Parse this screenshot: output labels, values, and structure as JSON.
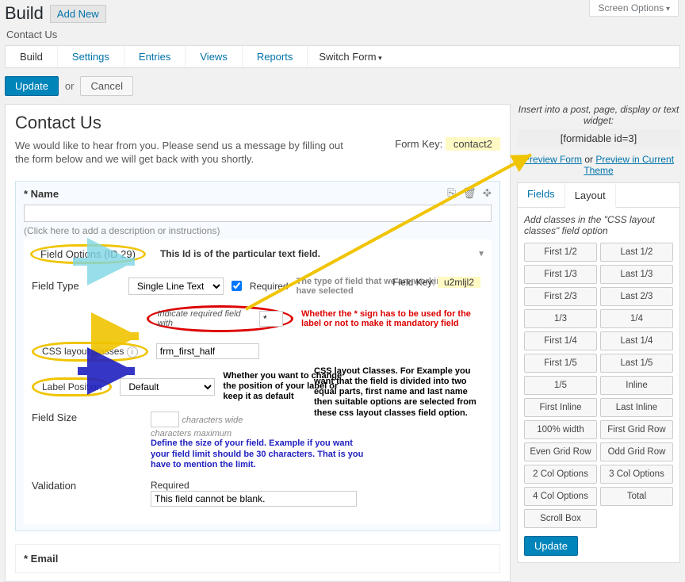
{
  "screen_options": "Screen Options",
  "page_title": "Build",
  "add_new": "Add New",
  "breadcrumb": "Contact Us",
  "tabs": [
    "Build",
    "Settings",
    "Entries",
    "Views",
    "Reports"
  ],
  "switch_form": "Switch Form",
  "update": "Update",
  "or": "or",
  "cancel": "Cancel",
  "form_title": "Contact Us",
  "form_intro": "We would like to hear from you. Please send us a message by filling out the form below and we will get back with you shortly.",
  "form_key_label": "Form Key:",
  "form_key_value": "contact2",
  "name_label": "Name",
  "desc_hint": "(Click here to add a description or instructions)",
  "field_options": "Field Options (ID 29)",
  "note_id": "This Id is of the particular text field.",
  "field_type_lbl": "Field Type",
  "field_type_val": "Single Line Text",
  "required_lbl": "Required",
  "field_type_note": "The type of field that we are working on or have selected",
  "field_key_lbl": "Field Key:",
  "field_key_val": "u2mljl2",
  "indicate_lbl": "Indicate required field with",
  "indicate_val": "*",
  "red_note": "Whether the * sign has to be used for the label or not to make it mandatory field",
  "css_lbl": "CSS layout classes",
  "css_val": "frm_first_half",
  "label_pos_lbl": "Label Position",
  "label_pos_val": "Default",
  "label_pos_note": "Whether you want to change the position of your label or keep it as default",
  "css_classes_note": "CSS layout Classes. For Example you want that the field is divided into two equal parts, first name and last name then suitable options are selected from these css layout classes field option.",
  "field_size_lbl": "Field Size",
  "field_size_unit": "characters wide",
  "field_size_max": "characters maximum",
  "size_note": "Define the size of your field. Example if you want your field limit should be 30 characters. That is you have to mention the limit.",
  "validation_lbl": "Validation",
  "validation_sub": "Required",
  "validation_msg": "This field cannot be blank.",
  "email_label": "Email",
  "sidebar": {
    "insert_hint": "Insert into a post, page, display or text widget:",
    "shortcode": "[formidable id=3]",
    "preview_form": "Preview Form",
    "or": "or",
    "preview_theme": "Preview in Current Theme",
    "tab_fields": "Fields",
    "tab_layout": "Layout",
    "layout_hint": "Add classes in the \"CSS layout classes\" field option",
    "classes": [
      "First 1/2",
      "Last 1/2",
      "First 1/3",
      "Last 1/3",
      "First 2/3",
      "Last 2/3",
      "1/3",
      "1/4",
      "First 1/4",
      "Last 1/4",
      "First 1/5",
      "Last 1/5",
      "1/5",
      "Inline",
      "First Inline",
      "Last Inline",
      "100% width",
      "First Grid Row",
      "Even Grid Row",
      "Odd Grid Row",
      "2 Col Options",
      "3 Col Options",
      "4 Col Options",
      "Total",
      "Scroll Box"
    ],
    "update": "Update"
  }
}
